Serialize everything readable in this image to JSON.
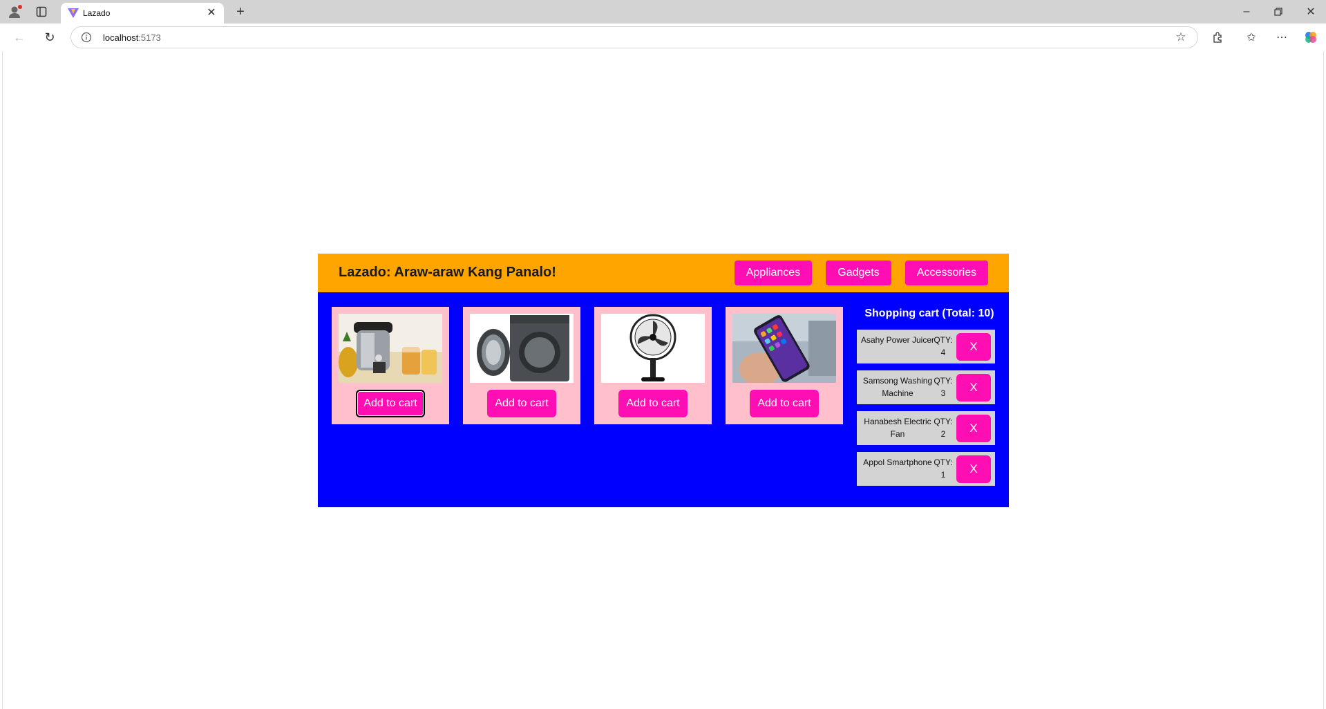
{
  "browser": {
    "tab_title": "Lazado",
    "url_host": "localhost",
    "url_port": ":5173"
  },
  "header": {
    "brand": "Lazado: Araw-araw Kang Panalo!",
    "nav": [
      "Appliances",
      "Gadgets",
      "Accessories"
    ]
  },
  "products": [
    {
      "image": "juicer-image",
      "button": "Add to cart"
    },
    {
      "image": "washing-machine-image",
      "button": "Add to cart"
    },
    {
      "image": "electric-fan-image",
      "button": "Add to cart"
    },
    {
      "image": "smartphone-image",
      "button": "Add to cart"
    }
  ],
  "cart": {
    "title": "Shopping cart (Total: 10)",
    "items": [
      {
        "name": "Asahy Power Juicer",
        "qty_label": "QTY:",
        "qty": "4",
        "remove": "X"
      },
      {
        "name": "Samsong Washing Machine",
        "qty_label": "QTY:",
        "qty": "3",
        "remove": "X"
      },
      {
        "name": "Hanabesh Electric Fan",
        "qty_label": "QTY:",
        "qty": "2",
        "remove": "X"
      },
      {
        "name": "Appol Smartphone",
        "qty_label": "QTY:",
        "qty": "1",
        "remove": "X"
      }
    ]
  },
  "colors": {
    "header_bg": "#ffa500",
    "body_bg": "#0000ff",
    "card_bg": "#ffc0cb",
    "button_bg": "#ff0fb3",
    "cart_item_bg": "#d3d3d3"
  }
}
